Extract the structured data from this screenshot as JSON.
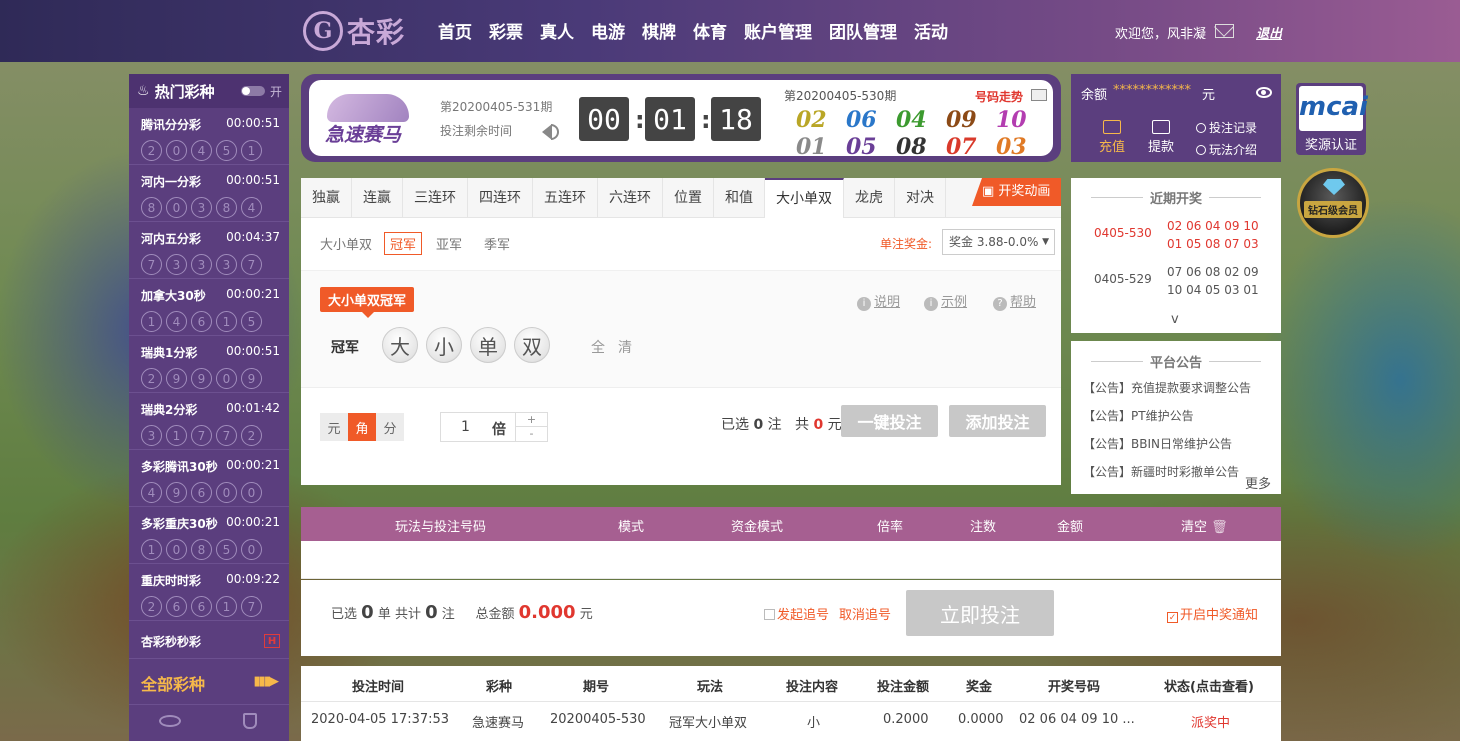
{
  "header": {
    "logo_mark": "G",
    "logo_text": "杏彩",
    "nav": [
      "首页",
      "彩票",
      "真人",
      "电游",
      "棋牌",
      "体育",
      "账户管理",
      "团队管理",
      "活动"
    ],
    "welcome": "欢迎您，风非凝",
    "logout": "退出"
  },
  "sidebar": {
    "title": "热门彩种",
    "toggle_label": "开",
    "items": [
      {
        "name": "腾讯分分彩",
        "time": "00:00:51",
        "balls": [
          "2",
          "0",
          "4",
          "5",
          "1"
        ]
      },
      {
        "name": "河内一分彩",
        "time": "00:00:51",
        "balls": [
          "8",
          "0",
          "3",
          "8",
          "4"
        ]
      },
      {
        "name": "河内五分彩",
        "time": "00:04:37",
        "balls": [
          "7",
          "3",
          "3",
          "3",
          "7"
        ]
      },
      {
        "name": "加拿大30秒",
        "time": "00:00:21",
        "balls": [
          "1",
          "4",
          "6",
          "1",
          "5"
        ]
      },
      {
        "name": "瑞典1分彩",
        "time": "00:00:51",
        "balls": [
          "2",
          "9",
          "9",
          "0",
          "9"
        ]
      },
      {
        "name": "瑞典2分彩",
        "time": "00:01:42",
        "balls": [
          "3",
          "1",
          "7",
          "7",
          "2"
        ]
      },
      {
        "name": "多彩腾讯30秒",
        "time": "00:00:21",
        "balls": [
          "4",
          "9",
          "6",
          "0",
          "0"
        ]
      },
      {
        "name": "多彩重庆30秒",
        "time": "00:00:21",
        "balls": [
          "1",
          "0",
          "8",
          "5",
          "0"
        ]
      },
      {
        "name": "重庆时时彩",
        "time": "00:09:22",
        "balls": [
          "2",
          "6",
          "6",
          "1",
          "7"
        ]
      }
    ],
    "xing_name": "杏彩秒秒彩",
    "xing_badge": "H",
    "all_label": "全部彩种",
    "all_arrows": "▮▮▮▶"
  },
  "game": {
    "logo_text": "急速赛马",
    "current_issue": "第20200405-531期",
    "remaining_label": "投注剩余时间",
    "countdown": [
      "00",
      "01",
      "18"
    ],
    "last_issue": "第20200405-530期",
    "trend_label": "号码走势",
    "results": [
      {
        "num": "02",
        "color": "#b9a626"
      },
      {
        "num": "06",
        "color": "#2a77c9"
      },
      {
        "num": "04",
        "color": "#3c9a2f"
      },
      {
        "num": "09",
        "color": "#8c4a16"
      },
      {
        "num": "10",
        "color": "#b33db0"
      },
      {
        "num": "01",
        "color": "#8a8a8a"
      },
      {
        "num": "05",
        "color": "#6a3f97"
      },
      {
        "num": "08",
        "color": "#333333"
      },
      {
        "num": "07",
        "color": "#d93a2b"
      },
      {
        "num": "03",
        "color": "#e07a26"
      }
    ]
  },
  "balance": {
    "label": "余额",
    "masked": "************",
    "unit": "元",
    "recharge": "充值",
    "withdraw": "提款",
    "records": "投注记录",
    "rules": "玩法介绍"
  },
  "badges": {
    "mcai": "mcai",
    "mcai_label": "奖源认证",
    "vip_label": "钻石级会员"
  },
  "tabs": [
    "独赢",
    "连赢",
    "三连环",
    "四连环",
    "五连环",
    "六连环",
    "位置",
    "和值",
    "大小单双",
    "龙虎",
    "对决"
  ],
  "active_tab": "大小单双",
  "draw_anim": "开奖动画",
  "subtabs": {
    "group": "大小单双",
    "items": [
      "冠军",
      "亚军",
      "季军"
    ],
    "prize_label": "单注奖金:",
    "prize_value": "奖金 3.88-0.0%"
  },
  "play": {
    "title": "大小单双冠军",
    "help": [
      "说明",
      "示例",
      "帮助"
    ],
    "position_label": "冠军",
    "options": [
      "大",
      "小",
      "单",
      "双"
    ],
    "quick_all": "全",
    "quick_clear": "清"
  },
  "bet": {
    "units": [
      "元",
      "角",
      "分"
    ],
    "active_unit": "角",
    "multiplier": "1",
    "mult_label": "倍",
    "selected_prefix": "已选",
    "selected_count": "0",
    "selected_suffix": "注",
    "total_prefix": "共",
    "total_amount": "0",
    "total_suffix": "元",
    "one_click": "一键投注",
    "add_bet": "添加投注"
  },
  "latest": {
    "title": "近期开奖",
    "rows": [
      {
        "issue": "0405-530",
        "nums": "02 06 04 09 10 01 05 08 07 03"
      },
      {
        "issue": "0405-529",
        "nums": "07 06 08 02 09 10 04 05 03 01"
      }
    ],
    "more": "v"
  },
  "notices": {
    "title": "平台公告",
    "items": [
      "【公告】充值提款要求调整公告",
      "【公告】PT维护公告",
      "【公告】BBIN日常维护公告",
      "【公告】新疆时时彩撤单公告"
    ],
    "more": "更多"
  },
  "list": {
    "columns": [
      "玩法与投注号码",
      "模式",
      "资金模式",
      "倍率",
      "注数",
      "金额",
      "清空"
    ]
  },
  "summary": {
    "selected": "已选",
    "count": "0",
    "unit_dan": "单 共计",
    "notes": "0",
    "note_unit": "注",
    "total_label": "总金额",
    "total_amount": "0.000",
    "yuan": "元",
    "chase": "发起追号",
    "cancel_chase": "取消追号",
    "submit": "立即投注",
    "notify": "开启中奖通知"
  },
  "history": {
    "columns": [
      "投注时间",
      "彩种",
      "期号",
      "玩法",
      "投注内容",
      "投注金额",
      "奖金",
      "开奖号码",
      "状态(点击查看)"
    ],
    "rows": [
      [
        "2020-04-05 17:37:53",
        "急速赛马",
        "20200405-530",
        "冠军大小单双",
        "小",
        "0.2000",
        "0.0000",
        "02 06 04 09 10 ...",
        "派奖中"
      ]
    ]
  }
}
